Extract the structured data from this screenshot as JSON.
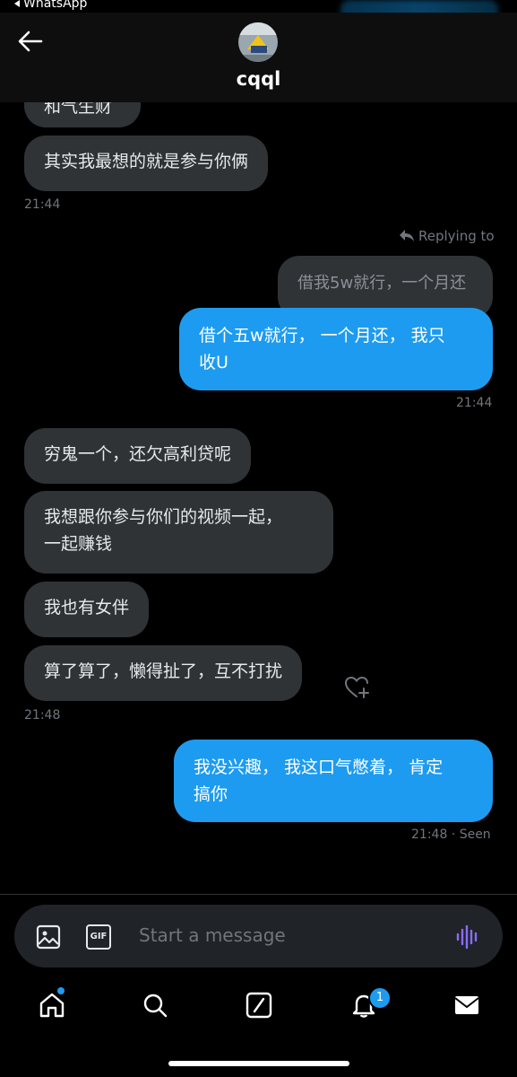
{
  "status": {
    "back_app_label": "WhatsApp"
  },
  "header": {
    "contact_name": "cqql"
  },
  "messages": {
    "cut_text": "和气生财",
    "m1": {
      "text": "其实我最想的就是参与你俩",
      "time": "21:44"
    },
    "reply": {
      "replying_to": "Replying to",
      "quoted": "借我5w就行，一个月还",
      "text_line1": "借个五w就行， 一个月还， 我只",
      "text_line2": "收U",
      "time": "21:44"
    },
    "m2": {
      "text": "穷鬼一个，还欠高利贷呢"
    },
    "m3": {
      "text_line1": "我想跟你参与你们的视频一起，",
      "text_line2": "一起赚钱"
    },
    "m4": {
      "text": "我也有女伴"
    },
    "m5": {
      "text": "算了算了，懒得扯了，互不打扰",
      "time": "21:48"
    },
    "out2": {
      "text_line1": "我没兴趣， 我这口气憋着， 肯定",
      "text_line2": "搞你",
      "time": "21:48 · Seen"
    }
  },
  "composer": {
    "placeholder": "Start a message",
    "gif_label": "GIF"
  },
  "nav": {
    "icons": [
      "home-icon",
      "search-icon",
      "grok-icon",
      "bell-icon",
      "mail-icon"
    ],
    "notifications_count": "1"
  },
  "colors": {
    "accent": "#1d9bf0",
    "incoming_bubble": "#2f3336",
    "background": "#000000"
  }
}
